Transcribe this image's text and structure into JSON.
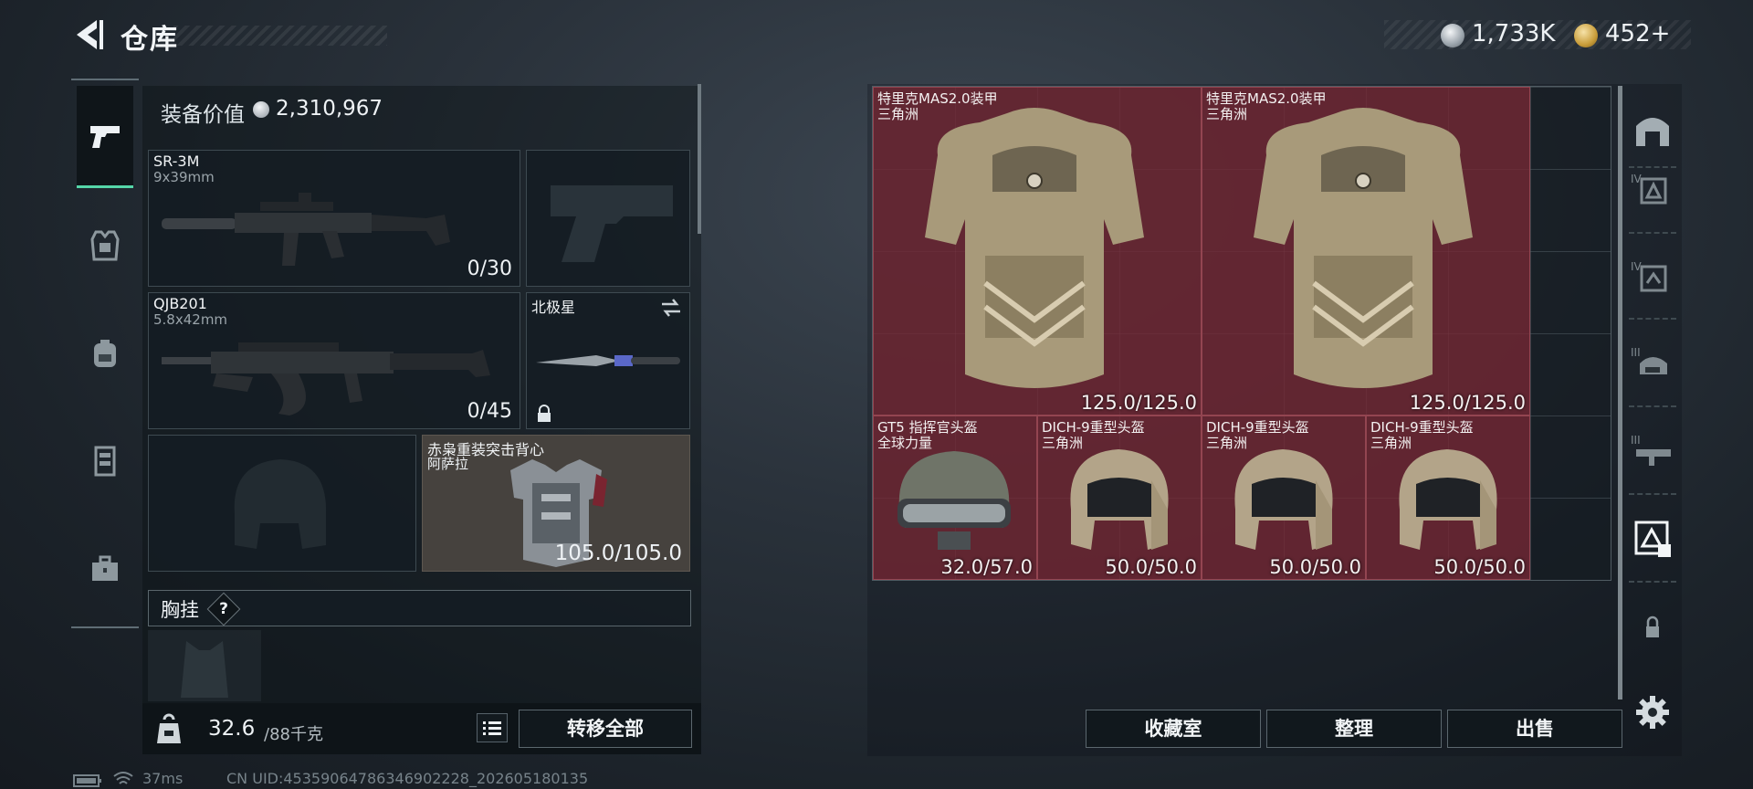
{
  "header": {
    "title": "仓库",
    "currency": {
      "silver": "1,733K",
      "gold": "452+"
    }
  },
  "left_nav": {
    "items": [
      "pistol-icon",
      "armor-icon",
      "backpack-icon",
      "chest-rig-icon",
      "toolbox-icon"
    ],
    "active": "pistol-icon"
  },
  "equipment": {
    "value_label": "装备价值",
    "value": "2,310,967",
    "primary": {
      "name": "SR-3M",
      "caliber": "9x39mm",
      "ammo": "0/30"
    },
    "secondary": {
      "name": "QJB201",
      "caliber": "5.8x42mm",
      "ammo": "0/45"
    },
    "melee": {
      "name": "北极星"
    },
    "vest": {
      "name": "赤枭重装突击背心",
      "origin": "阿萨拉",
      "durability": "105.0/105.0"
    },
    "chest_rig_label": "胸挂",
    "help": "?"
  },
  "weight": {
    "current": "32.6",
    "max": "/88千克"
  },
  "buttons": {
    "transfer_all": "转移全部",
    "collection": "收藏室",
    "organize": "整理",
    "sell": "出售"
  },
  "stash_items": [
    {
      "name": "特里克MAS2.0装甲",
      "origin": "三角洲",
      "durability": "125.0/125.0",
      "kind": "armor"
    },
    {
      "name": "特里克MAS2.0装甲",
      "origin": "三角洲",
      "durability": "125.0/125.0",
      "kind": "armor"
    },
    {
      "name": "GT5 指挥官头盔",
      "origin": "全球力量",
      "durability": "32.0/57.0",
      "kind": "helmet-gt5"
    },
    {
      "name": "DICH-9重型头盔",
      "origin": "三角洲",
      "durability": "50.0/50.0",
      "kind": "helmet"
    },
    {
      "name": "DICH-9重型头盔",
      "origin": "三角洲",
      "durability": "50.0/50.0",
      "kind": "helmet"
    },
    {
      "name": "DICH-9重型头盔",
      "origin": "三角洲",
      "durability": "50.0/50.0",
      "kind": "helmet"
    }
  ],
  "right_rail": {
    "items": [
      "stash-main-icon",
      "tier-iv-armor-icon",
      "tier-iv-armor-icon-2",
      "tier-iii-helmet-icon",
      "tier-iii-weapon-icon",
      "armor-filter-icon",
      "lock-icon"
    ],
    "active": "armor-filter-icon"
  },
  "status": {
    "ping": "37ms",
    "uid": "CN UID:4535906478634690222​8_202605180135"
  },
  "colors": {
    "accent": "#55d6a8",
    "item_highlight": "#762834",
    "panel": "#141d23"
  }
}
